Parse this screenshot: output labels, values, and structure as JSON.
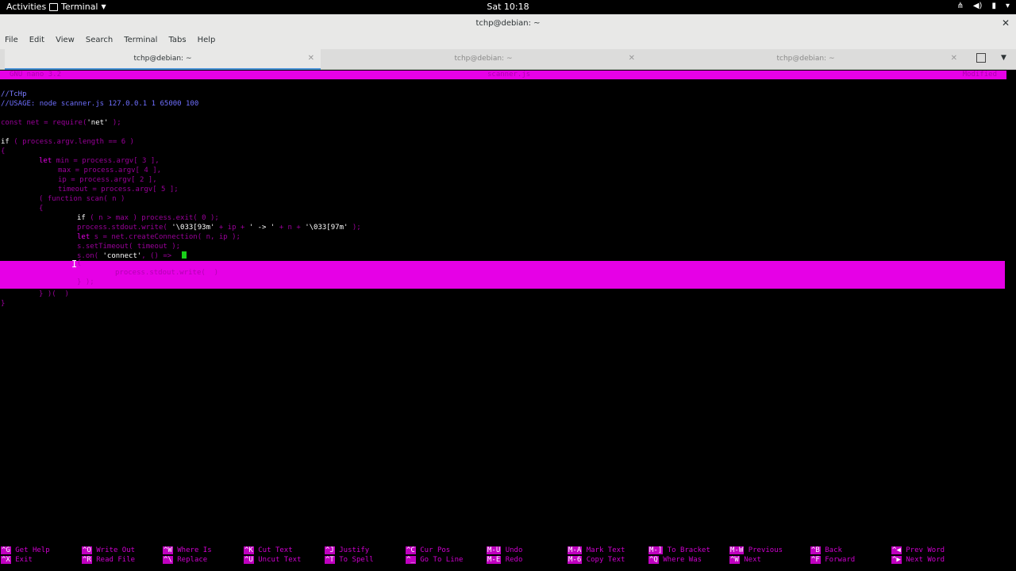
{
  "topbar": {
    "activities": "Activities",
    "app": "Terminal",
    "clock": "Sat 10:18",
    "status_icons": [
      "network-icon",
      "volume-icon",
      "battery-icon",
      "power-menu-icon"
    ]
  },
  "window": {
    "title": "tchp@debian: ~",
    "menu": [
      "File",
      "Edit",
      "View",
      "Search",
      "Terminal",
      "Tabs",
      "Help"
    ],
    "tabs": [
      {
        "label": "tchp@debian: ~",
        "active": true
      },
      {
        "label": "tchp@debian: ~",
        "active": false
      },
      {
        "label": "tchp@debian: ~",
        "active": false
      }
    ]
  },
  "nano": {
    "version": "GNU nano 3.2",
    "filename": "scanner.js",
    "status": "Modified"
  },
  "code": {
    "l1": "//TcHp",
    "l2": "//USAGE: node scanner.js 127.0.0.1 1 65000 100",
    "l3a": "const net = require(",
    "l3b": "'net'",
    "l3c": " );",
    "l4a": "if",
    "l4b": " ( process.argv.length == 6 )",
    "l5": "{",
    "l6a": "let",
    "l6b": " min = process.argv[ 3 ],",
    "l7": "max = process.argv[ 4 ],",
    "l8": "ip = process.argv[ 2 ],",
    "l9": "timeout = process.argv[ 5 ];",
    "l10": "( function scan( n )",
    "l11": "{",
    "l12a": "if",
    "l12b": " ( n > max ) process.exit( 0 );",
    "l13a": "process.stdout.write( ",
    "l13b": "'\\033[93m'",
    "l13c": " + ip + ",
    "l13d": "' -> '",
    "l13e": " + n + ",
    "l13f": "'\\033[97m'",
    "l13g": " );",
    "l14a": "let",
    "l14b": " s = net.createConnection( n, ip );",
    "l15": "s.setTimeout( timeout );",
    "l16a": "s.on( ",
    "l16b": "'connect'",
    "l16c": ", () =>",
    "sel1": "{",
    "sel2": "process.stdout.write(  )",
    "sel3": "} );",
    "l18": "} )(  )",
    "l19": "}"
  },
  "shortcuts": [
    {
      "k1": "^G",
      "d1": "Get Help",
      "k2": "^X",
      "d2": "Exit"
    },
    {
      "k1": "^O",
      "d1": "Write Out",
      "k2": "^R",
      "d2": "Read File"
    },
    {
      "k1": "^W",
      "d1": "Where Is",
      "k2": "^\\",
      "d2": "Replace"
    },
    {
      "k1": "^K",
      "d1": "Cut Text",
      "k2": "^U",
      "d2": "Uncut Text"
    },
    {
      "k1": "^J",
      "d1": "Justify",
      "k2": "^T",
      "d2": "To Spell"
    },
    {
      "k1": "^C",
      "d1": "Cur Pos",
      "k2": "^_",
      "d2": "Go To Line"
    },
    {
      "k1": "M-U",
      "d1": "Undo",
      "k2": "M-E",
      "d2": "Redo"
    },
    {
      "k1": "M-A",
      "d1": "Mark Text",
      "k2": "M-6",
      "d2": "Copy Text"
    },
    {
      "k1": "M-]",
      "d1": "To Bracket",
      "k2": "^Q",
      "d2": "Where Was"
    },
    {
      "k1": "M-W",
      "d1": "Previous",
      "k2": "^W",
      "d2": "Next"
    },
    {
      "k1": "^B",
      "d1": "Back",
      "k2": "^F",
      "d2": "Forward"
    },
    {
      "k1": "^◀",
      "d1": "Prev Word",
      "k2": "^▶",
      "d2": "Next Word"
    }
  ]
}
